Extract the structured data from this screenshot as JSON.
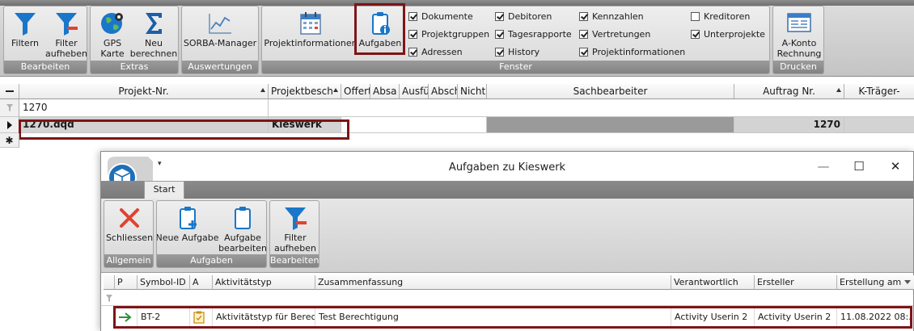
{
  "ribbon": {
    "groups": {
      "bearbeiten": "Bearbeiten",
      "extras": "Extras",
      "auswertungen": "Auswertungen",
      "fenster": "Fenster",
      "drucken": "Drucken"
    },
    "buttons": {
      "filtern": "Filtern",
      "filter_aufheben_1": "Filter",
      "filter_aufheben_2": "aufheben",
      "gps_1": "GPS",
      "gps_2": "Karte",
      "neu_1": "Neu",
      "neu_2": "berechnen",
      "sorba": "SORBA-Manager",
      "projektinfo": "Projektinformationen",
      "aufgaben": "Aufgaben",
      "akonto_1": "A-Konto",
      "akonto_2": "Rechnung"
    },
    "checkboxes": [
      {
        "label": "Dokumente",
        "checked": true
      },
      {
        "label": "Projektgruppen",
        "checked": true
      },
      {
        "label": "Adressen",
        "checked": true
      },
      {
        "label": "Debitoren",
        "checked": true
      },
      {
        "label": "Tagesrapporte",
        "checked": true
      },
      {
        "label": "History",
        "checked": true
      },
      {
        "label": "Kennzahlen",
        "checked": true
      },
      {
        "label": "Vertretungen",
        "checked": true
      },
      {
        "label": "Projektinformationen",
        "checked": true
      },
      {
        "label": "Kreditoren",
        "checked": false
      },
      {
        "label": "Unterprojekte",
        "checked": true
      }
    ]
  },
  "grid": {
    "columns": {
      "projekt_nr": "Projekt-Nr.",
      "projektbesch": "Projektbesch",
      "offert": "Offert",
      "absa": "Absa",
      "ausfu": "Ausfü",
      "absch": "Absch",
      "nicht": "Nicht",
      "sachbearbeiter": "Sachbearbeiter",
      "auftrag_nr": "Auftrag Nr.",
      "k_traeger": "K-Träger-"
    },
    "filter_value": "1270",
    "row": {
      "projekt_nr": "1270.dqd",
      "projektbesch": "Kieswerk",
      "checks": [
        false,
        false,
        true,
        false,
        false
      ],
      "auftrag_nr": "1270"
    },
    "new_row_marker": "✱"
  },
  "dialog": {
    "title": "Aufgaben zu Kieswerk",
    "quick_access": "▾",
    "tab_start": "Start",
    "window_buttons": {
      "minimize": "—",
      "maximize": "☐",
      "close": "✕"
    },
    "groups": {
      "allgemein": "Allgemein",
      "aufgaben": "Aufgaben",
      "bearbeiten": "Bearbeiten"
    },
    "buttons": {
      "schliessen": "Schliessen",
      "neue_aufgabe": "Neue Aufgabe",
      "aufgabe_bearbeiten_1": "Aufgabe",
      "aufgabe_bearbeiten_2": "bearbeiten",
      "filter_aufheben_1": "Filter",
      "filter_aufheben_2": "aufheben"
    },
    "columns": {
      "p": "P",
      "symbol_id": "Symbol-ID",
      "a": "A",
      "aktivitaetstyp": "Aktivitätstyp",
      "zusammenfassung": "Zusammenfassung",
      "verantwortlich": "Verantwortlich",
      "ersteller": "Ersteller",
      "erstellung_am": "Erstellung am"
    },
    "row": {
      "symbol_id": "BT-2",
      "aktivitaetstyp": "Aktivitätstyp für Berec…",
      "zusammenfassung": "Test Berechtigung",
      "verantwortlich": "Activity Userin 2",
      "ersteller": "Activity Userin 2",
      "erstellung_am": "11.08.2022 08:…"
    }
  },
  "colors": {
    "highlight": "#7d1517",
    "accent_blue": "#1a76c9",
    "red_x": "#e0432f"
  }
}
